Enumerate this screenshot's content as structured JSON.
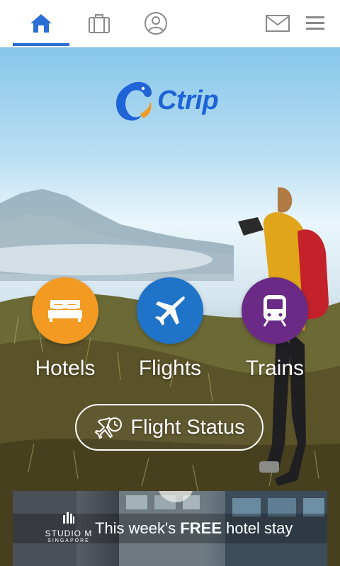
{
  "nav": {
    "tabs": [
      {
        "name": "home",
        "icon": "home-icon",
        "active": true
      },
      {
        "name": "trips",
        "icon": "suitcase-icon",
        "active": false
      },
      {
        "name": "account",
        "icon": "user-icon",
        "active": false
      }
    ],
    "actions": [
      {
        "name": "messages",
        "icon": "mail-icon"
      },
      {
        "name": "menu",
        "icon": "hamburger-menu-icon"
      }
    ],
    "active_color": "#2b6fd4",
    "icon_color": "#8a8a8a"
  },
  "hero": {
    "logo_text": "Ctrip",
    "logo_color": "#1f63d6",
    "services": [
      {
        "label": "Hotels",
        "icon": "bed-icon",
        "color": "#f29a22"
      },
      {
        "label": "Flights",
        "icon": "airplane-icon",
        "color": "#1f73c8"
      },
      {
        "label": "Trains",
        "icon": "train-icon",
        "color": "#6a2a86"
      }
    ],
    "flight_status_label": "Flight Status",
    "flight_status_icon": "flight-clock-icon"
  },
  "banner": {
    "brand_name": "STUDIO M",
    "brand_city": "SINGAPORE",
    "text_before": "This week's ",
    "text_bold": "FREE",
    "text_after": " hotel stay"
  }
}
